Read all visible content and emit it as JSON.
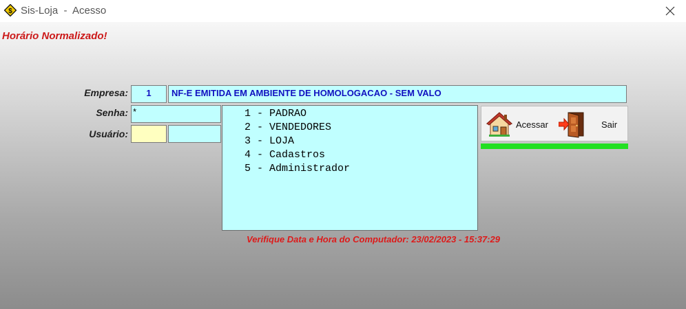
{
  "window": {
    "title": "Sis-Loja  -  Acesso",
    "icon": "sis-loja-diamond-icon",
    "close_glyph": "✕"
  },
  "status_message": "Horário Normalizado!",
  "form": {
    "empresa": {
      "label": "Empresa:",
      "code": "1",
      "name": "NF-E EMITIDA EM AMBIENTE DE HOMOLOGACAO - SEM VALO"
    },
    "senha": {
      "label": "Senha:",
      "value": "*"
    },
    "usuario": {
      "label": "Usuário:",
      "code": "",
      "name": ""
    }
  },
  "profile_list": {
    "items": [
      {
        "label": "1 - PADRAO"
      },
      {
        "label": "2 - VENDEDORES"
      },
      {
        "label": "3 - LOJA"
      },
      {
        "label": "4 - Cadastros"
      },
      {
        "label": "5 - Administrador"
      }
    ]
  },
  "buttons": {
    "acessar": {
      "label": "Acessar",
      "icon": "house-icon"
    },
    "sair": {
      "label": "Sair",
      "icon": "exit-door-icon"
    }
  },
  "footer_warning": "Verifique Data e Hora do Computador: 23/02/2023 - 15:37:29",
  "colors": {
    "field_bg": "#c0ffff",
    "field_text": "#1010c0",
    "status_red": "#cc1a1a",
    "progress_green": "#22e022",
    "usuario_code_bg": "#ffffc0"
  }
}
